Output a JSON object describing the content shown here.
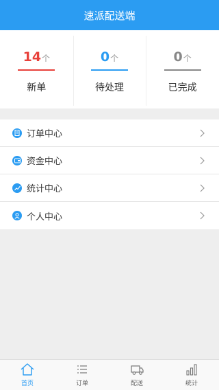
{
  "header": {
    "title": "速派配送端"
  },
  "stats": [
    {
      "count": "14",
      "unit": "个",
      "label": "新单",
      "color": "#e8403a"
    },
    {
      "count": "0",
      "unit": "个",
      "label": "待处理",
      "color": "#2b9cf2"
    },
    {
      "count": "0",
      "unit": "个",
      "label": "已完成",
      "color": "#888888"
    }
  ],
  "menu": [
    {
      "label": "订单中心",
      "icon": "document-icon"
    },
    {
      "label": "资金中心",
      "icon": "wallet-icon"
    },
    {
      "label": "统计中心",
      "icon": "trend-chart-icon"
    },
    {
      "label": "个人中心",
      "icon": "user-icon"
    }
  ],
  "tabs": [
    {
      "label": "首页",
      "icon": "home-icon",
      "active": true
    },
    {
      "label": "订单",
      "icon": "list-icon",
      "active": false
    },
    {
      "label": "配送",
      "icon": "delivery-icon",
      "active": false
    },
    {
      "label": "统计",
      "icon": "bar-chart-icon",
      "active": false
    }
  ],
  "colors": {
    "accent": "#2b9cf2",
    "new_order": "#e8403a",
    "done": "#888888"
  }
}
